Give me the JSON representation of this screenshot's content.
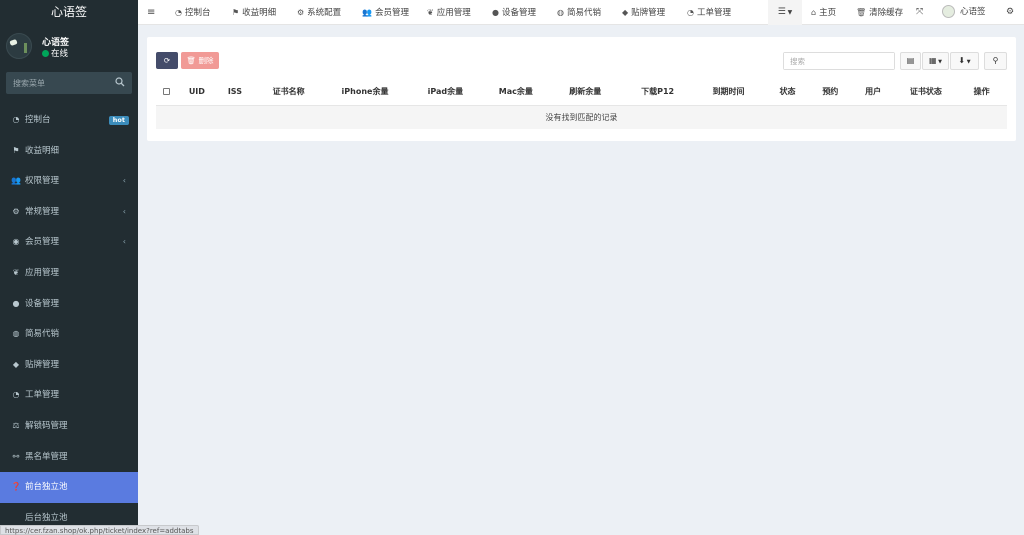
{
  "app": {
    "title": "心语签"
  },
  "user": {
    "name": "心语签",
    "status": "在线"
  },
  "sidebar": {
    "search_placeholder": "搜索菜单",
    "items": [
      {
        "label": "控制台",
        "icon": "dashboard-icon",
        "badge": "hot"
      },
      {
        "label": "收益明细",
        "icon": "flag-icon"
      },
      {
        "label": "权限管理",
        "icon": "group-icon",
        "has_submenu": true
      },
      {
        "label": "常规管理",
        "icon": "cogs-icon",
        "has_submenu": true
      },
      {
        "label": "会员管理",
        "icon": "user-circle-icon",
        "has_submenu": true
      },
      {
        "label": "应用管理",
        "icon": "leaf-icon"
      },
      {
        "label": "设备管理",
        "icon": "circle-icon"
      },
      {
        "label": "简易代销",
        "icon": "globe-icon"
      },
      {
        "label": "贴牌管理",
        "icon": "tag-icon"
      },
      {
        "label": "工单管理",
        "icon": "tachometer-icon"
      },
      {
        "label": "解锁码管理",
        "icon": "balance-icon"
      },
      {
        "label": "黑名单管理",
        "icon": "bicycle-icon"
      },
      {
        "label": "前台独立池",
        "icon": "question-circle-icon",
        "active": true
      },
      {
        "label": "后台独立池",
        "icon": "apple-icon"
      }
    ]
  },
  "navbar": {
    "items": [
      {
        "label": "控制台",
        "icon": "dashboard-icon"
      },
      {
        "label": "收益明细",
        "icon": "flag-icon"
      },
      {
        "label": "系统配置",
        "icon": "cog-icon"
      },
      {
        "label": "会员管理",
        "icon": "users-icon"
      },
      {
        "label": "应用管理",
        "icon": "leaf-icon"
      },
      {
        "label": "设备管理",
        "icon": "circle-icon"
      },
      {
        "label": "简易代销",
        "icon": "globe-icon"
      },
      {
        "label": "贴牌管理",
        "icon": "tag-icon"
      },
      {
        "label": "工单管理",
        "icon": "tachometer-icon"
      }
    ],
    "home_label": "主页",
    "clear_cache_label": "清除缓存",
    "account_label": "心语签"
  },
  "toolbar": {
    "delete_label": "删除",
    "search_placeholder": "搜索"
  },
  "table": {
    "columns": [
      "UID",
      "ISS",
      "证书名称",
      "iPhone余量",
      "iPad余量",
      "Mac余量",
      "刷新余量",
      "下载P12",
      "到期时间",
      "状态",
      "预约",
      "用户",
      "证书状态",
      "操作"
    ],
    "empty_text": "没有找到匹配的记录"
  },
  "statusbar": {
    "url": "https://cer.fzan.shop/ok.php/ticket/index?ref=addtabs"
  },
  "colors": {
    "sidebar_bg": "#222d32",
    "active_item": "#5a7be0",
    "delete_button": "#f19a96",
    "refresh_button": "#444c6a"
  }
}
